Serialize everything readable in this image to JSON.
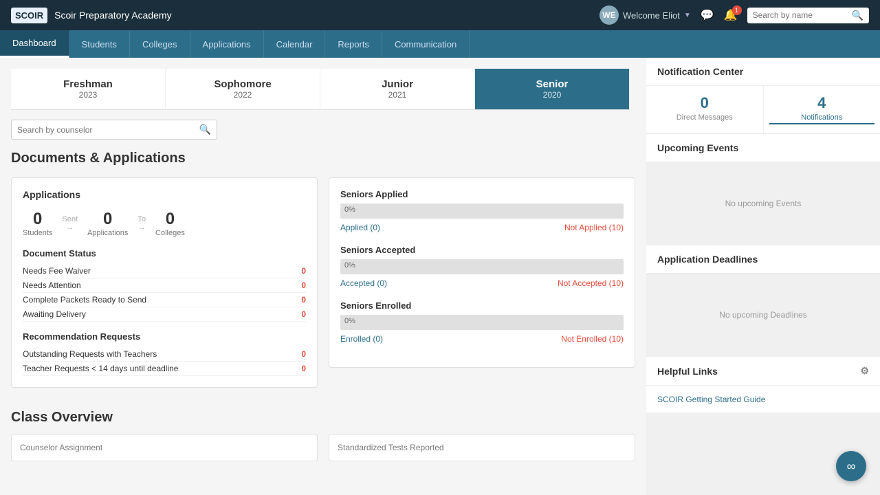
{
  "app": {
    "logo": "SCOIR",
    "school_name": "Scoir Preparatory Academy",
    "welcome": "Welcome Eliot",
    "search_placeholder": "Search by name"
  },
  "nav": {
    "items": [
      {
        "label": "Dashboard",
        "active": true
      },
      {
        "label": "Students",
        "active": false
      },
      {
        "label": "Colleges",
        "active": false
      },
      {
        "label": "Applications",
        "active": false
      },
      {
        "label": "Calendar",
        "active": false
      },
      {
        "label": "Reports",
        "active": false
      },
      {
        "label": "Communication",
        "active": false
      }
    ]
  },
  "grade_tabs": [
    {
      "name": "Freshman",
      "year": "2023",
      "active": false
    },
    {
      "name": "Sophomore",
      "year": "2022",
      "active": false
    },
    {
      "name": "Junior",
      "year": "2021",
      "active": false
    },
    {
      "name": "Senior",
      "year": "2020",
      "active": true
    }
  ],
  "counselor_search": {
    "placeholder": "Search by counselor"
  },
  "documents_applications": {
    "heading": "Documents & Applications",
    "applications": {
      "title": "Applications",
      "students": {
        "value": 0,
        "label": "Students"
      },
      "sent_label": "Sent",
      "applications": {
        "value": 0,
        "label": "Applications"
      },
      "to_label": "To",
      "colleges": {
        "value": 0,
        "label": "Colleges"
      }
    },
    "document_status": {
      "title": "Document Status",
      "rows": [
        {
          "label": "Needs Fee Waiver",
          "count": 0
        },
        {
          "label": "Needs Attention",
          "count": 0
        },
        {
          "label": "Complete Packets Ready to Send",
          "count": 0
        },
        {
          "label": "Awaiting Delivery",
          "count": 0
        }
      ]
    },
    "recommendation_requests": {
      "title": "Recommendation Requests",
      "rows": [
        {
          "label": "Outstanding Requests with Teachers",
          "count": 0
        },
        {
          "label": "Teacher Requests < 14 days until deadline",
          "count": 0
        }
      ]
    }
  },
  "seniors": {
    "applied": {
      "title": "Seniors Applied",
      "percent": "0%",
      "applied_label": "Applied (0)",
      "not_applied_label": "Not Applied (10)"
    },
    "accepted": {
      "title": "Seniors Accepted",
      "percent": "0%",
      "accepted_label": "Accepted (0)",
      "not_accepted_label": "Not Accepted (10)"
    },
    "enrolled": {
      "title": "Seniors Enrolled",
      "percent": "0%",
      "enrolled_label": "Enrolled (0)",
      "not_enrolled_label": "Not Enrolled (10)"
    }
  },
  "class_overview": {
    "heading": "Class Overview",
    "counselor_assignment_label": "Counselor Assignment",
    "standardized_tests_label": "Standardized Tests Reported"
  },
  "notification_center": {
    "title": "Notification Center",
    "direct_messages": {
      "value": 0,
      "label": "Direct Messages"
    },
    "notifications": {
      "value": 4,
      "label": "Notifications"
    }
  },
  "upcoming_events": {
    "title": "Upcoming Events",
    "empty_text": "No upcoming Events"
  },
  "application_deadlines": {
    "title": "Application Deadlines",
    "empty_text": "No upcoming Deadlines"
  },
  "helpful_links": {
    "title": "Helpful Links",
    "links": [
      {
        "label": "SCOIR Getting Started Guide"
      }
    ]
  }
}
